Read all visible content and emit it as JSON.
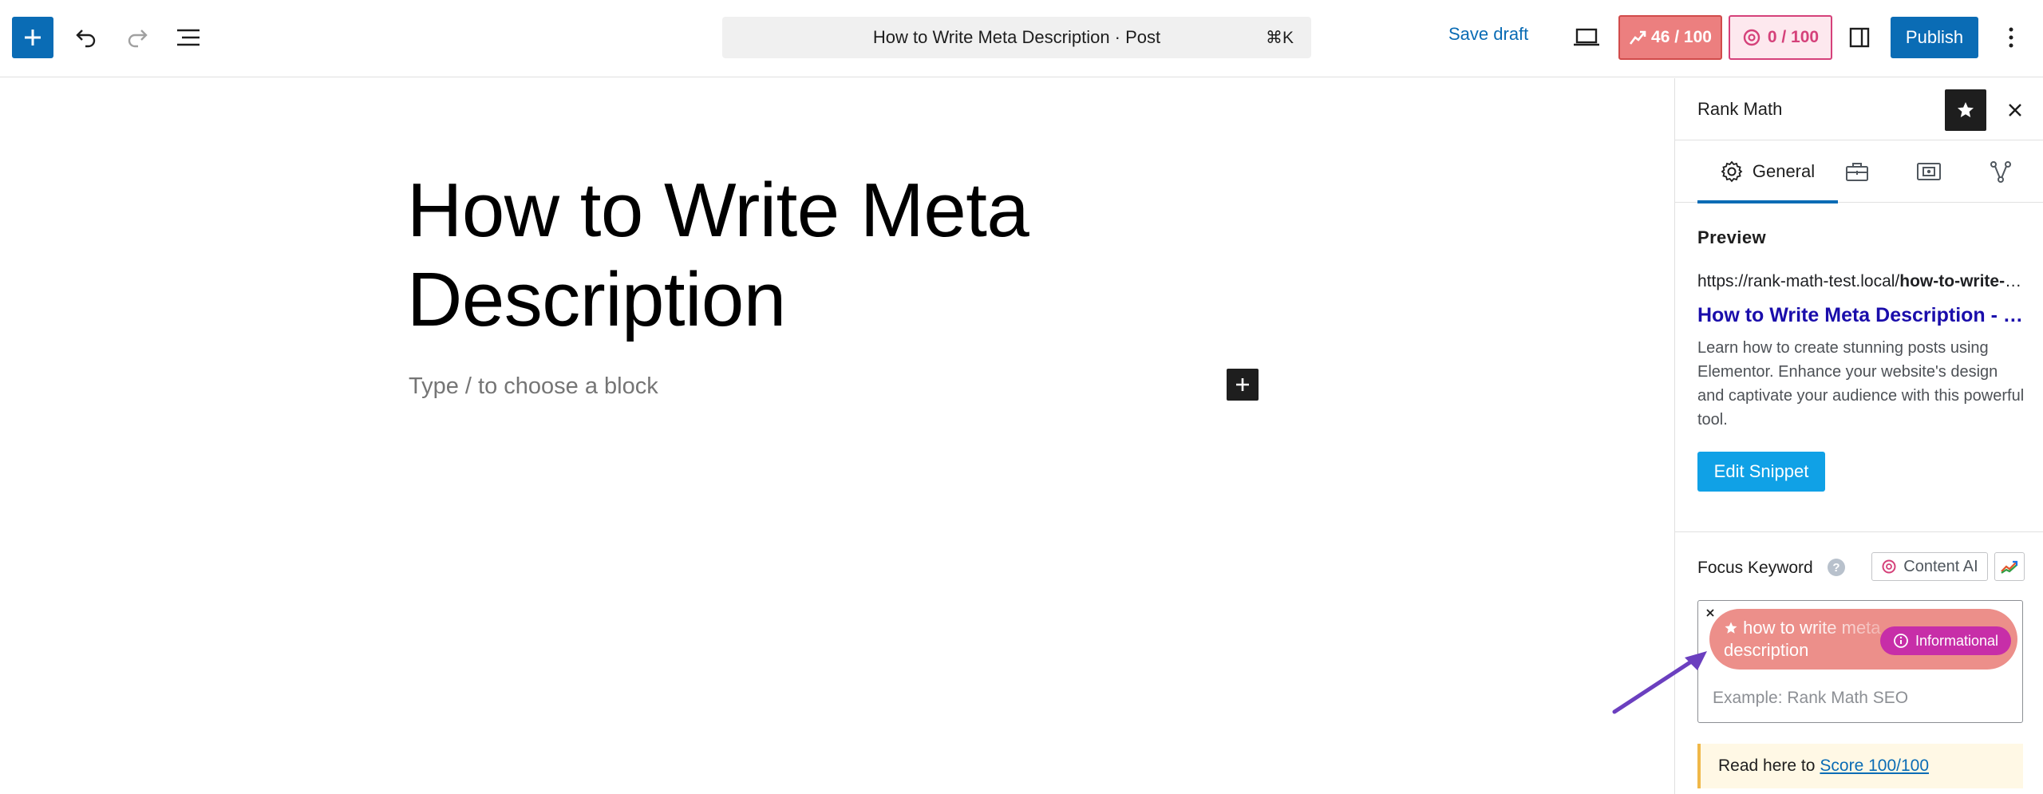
{
  "toolbar": {
    "document_title": "How to Write Meta Description · Post",
    "shortcut": "⌘K",
    "save_draft": "Save draft",
    "seo_score": "46 / 100",
    "ai_score": "0 / 100",
    "publish": "Publish"
  },
  "editor": {
    "post_title": "How to Write Meta Description",
    "block_placeholder": "Type / to choose a block"
  },
  "sidebar": {
    "title": "Rank Math",
    "tabs": {
      "general": "General"
    },
    "preview": {
      "heading": "Preview",
      "url_base": "https://rank-math-test.local/",
      "url_slug": "how-to-write-meta-description/",
      "title": "How to Write Meta Description - Rank Math",
      "description": "Learn how to create stunning posts using Elementor. Enhance your website's design and captivate your audience with this powerful tool.",
      "edit_snippet": "Edit Snippet"
    },
    "focus_keyword": {
      "label": "Focus Keyword",
      "help": "?",
      "content_ai": "Content AI",
      "keyword": "how to write meta description",
      "intent": "Informational",
      "placeholder": "Example: Rank Math SEO"
    },
    "notice": {
      "prefix": "Read here to",
      "link": "Score 100/100"
    }
  },
  "colors": {
    "accent": "#0a6cb5",
    "seo_score_bg": "#ec7f7f",
    "ai_score": "#d5417a",
    "keyword_tag": "#ec8f8a",
    "intent_badge": "#c72ea8",
    "snippet_title": "#1a0dab",
    "annotation_arrow": "#6b3fbf"
  }
}
